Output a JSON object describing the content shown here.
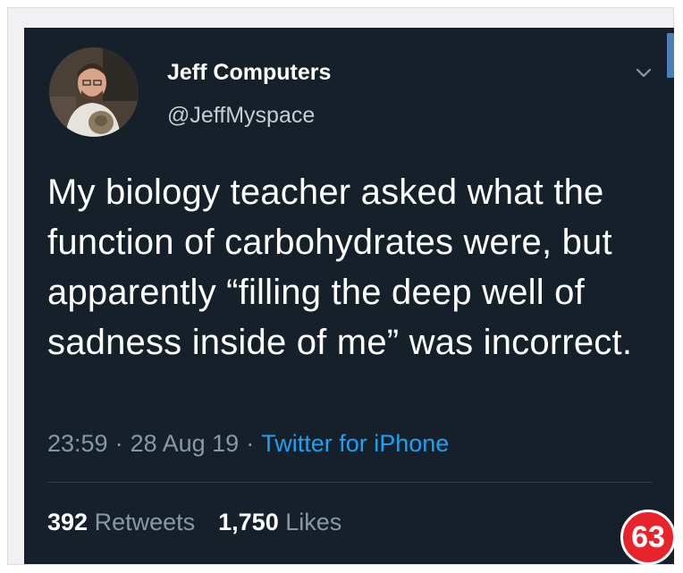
{
  "user": {
    "display_name": "Jeff Computers",
    "handle": "@JeffMyspace"
  },
  "tweet": {
    "text": "My biology teacher asked what the function of carbohydrates were, but apparently “filling the deep well of sadness inside of me” was incorrect.",
    "time": "23:59",
    "separator": "·",
    "date": "28 Aug 19",
    "source": "Twitter for iPhone"
  },
  "stats": {
    "retweets_count": "392",
    "retweets_label": "Retweets",
    "likes_count": "1,750",
    "likes_label": "Likes"
  },
  "badge": {
    "number": "63"
  },
  "icons": {
    "menu": "chevron-down-icon",
    "avatar": "avatar"
  },
  "colors": {
    "background": "#15202b",
    "link": "#1da1f2",
    "muted": "#8899a6",
    "badge": "#e8232b"
  }
}
